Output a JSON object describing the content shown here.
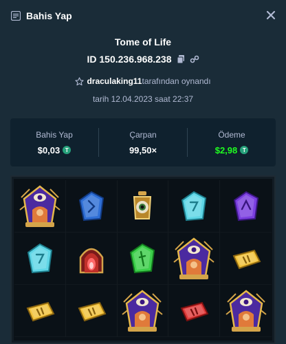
{
  "header": {
    "title": "Bahis Yap"
  },
  "game": {
    "title": "Tome of Life",
    "bet_id": "ID 150.236.968.238",
    "player_name": "draculaking11",
    "played_by_suffix": "tarafından oynandı",
    "date_line": "tarih 12.04.2023 saat 22:37"
  },
  "stats": {
    "bet_label": "Bahis Yap",
    "bet_value": "$0,03",
    "multiplier_label": "Çarpan",
    "multiplier_value": "99,50×",
    "payout_label": "Ödeme",
    "payout_value": "$2,98",
    "payout_color": "#1fff20",
    "currency_icon": "tether-coin-icon"
  },
  "board": {
    "rows": [
      [
        "eye-idol-symbol",
        "blue-rune-symbol",
        "golden-eye-lantern-symbol",
        "cyan-rune-symbol",
        "purple-rune-symbol"
      ],
      [
        "cyan-rune-symbol",
        "red-flame-arch-symbol",
        "green-rune-symbol",
        "eye-idol-symbol",
        "yellow-rune-symbol"
      ],
      [
        "yellow-rune-symbol",
        "yellow-rune-symbol",
        "eye-idol-symbol",
        "red-rune-symbol",
        "eye-idol-symbol"
      ]
    ]
  }
}
